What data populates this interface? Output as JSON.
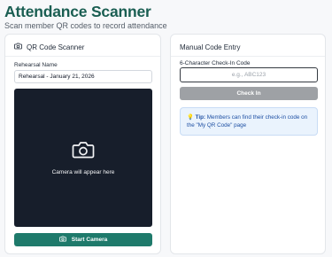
{
  "header": {
    "title": "Attendance Scanner",
    "subtitle": "Scan member QR codes to record attendance"
  },
  "scanner": {
    "title": "QR Code Scanner",
    "title_icon": "camera-icon",
    "rehearsal_label": "Rehearsal Name",
    "rehearsal_value": "Rehearsal - January 21, 2026",
    "camera_placeholder": "Camera will appear here",
    "camera_icon": "camera-icon",
    "start_button": "Start Camera",
    "start_button_icon": "camera-icon"
  },
  "manual": {
    "title": "Manual Code Entry",
    "code_label": "6-Character Check-In Code",
    "code_placeholder": "e.g., ABC123",
    "checkin_button": "Check In",
    "tip_icon": "lightbulb-icon",
    "tip_label": "Tip:",
    "tip_text": "Members can find their check-in code on the \"My QR Code\" page"
  },
  "colors": {
    "accent": "#1f7a6b",
    "title": "#1a5e52",
    "camera_bg": "#171e2b",
    "disabled_button": "#9ea1a5",
    "tip_bg": "#eaf3fd",
    "tip_text": "#1d4fa3"
  }
}
